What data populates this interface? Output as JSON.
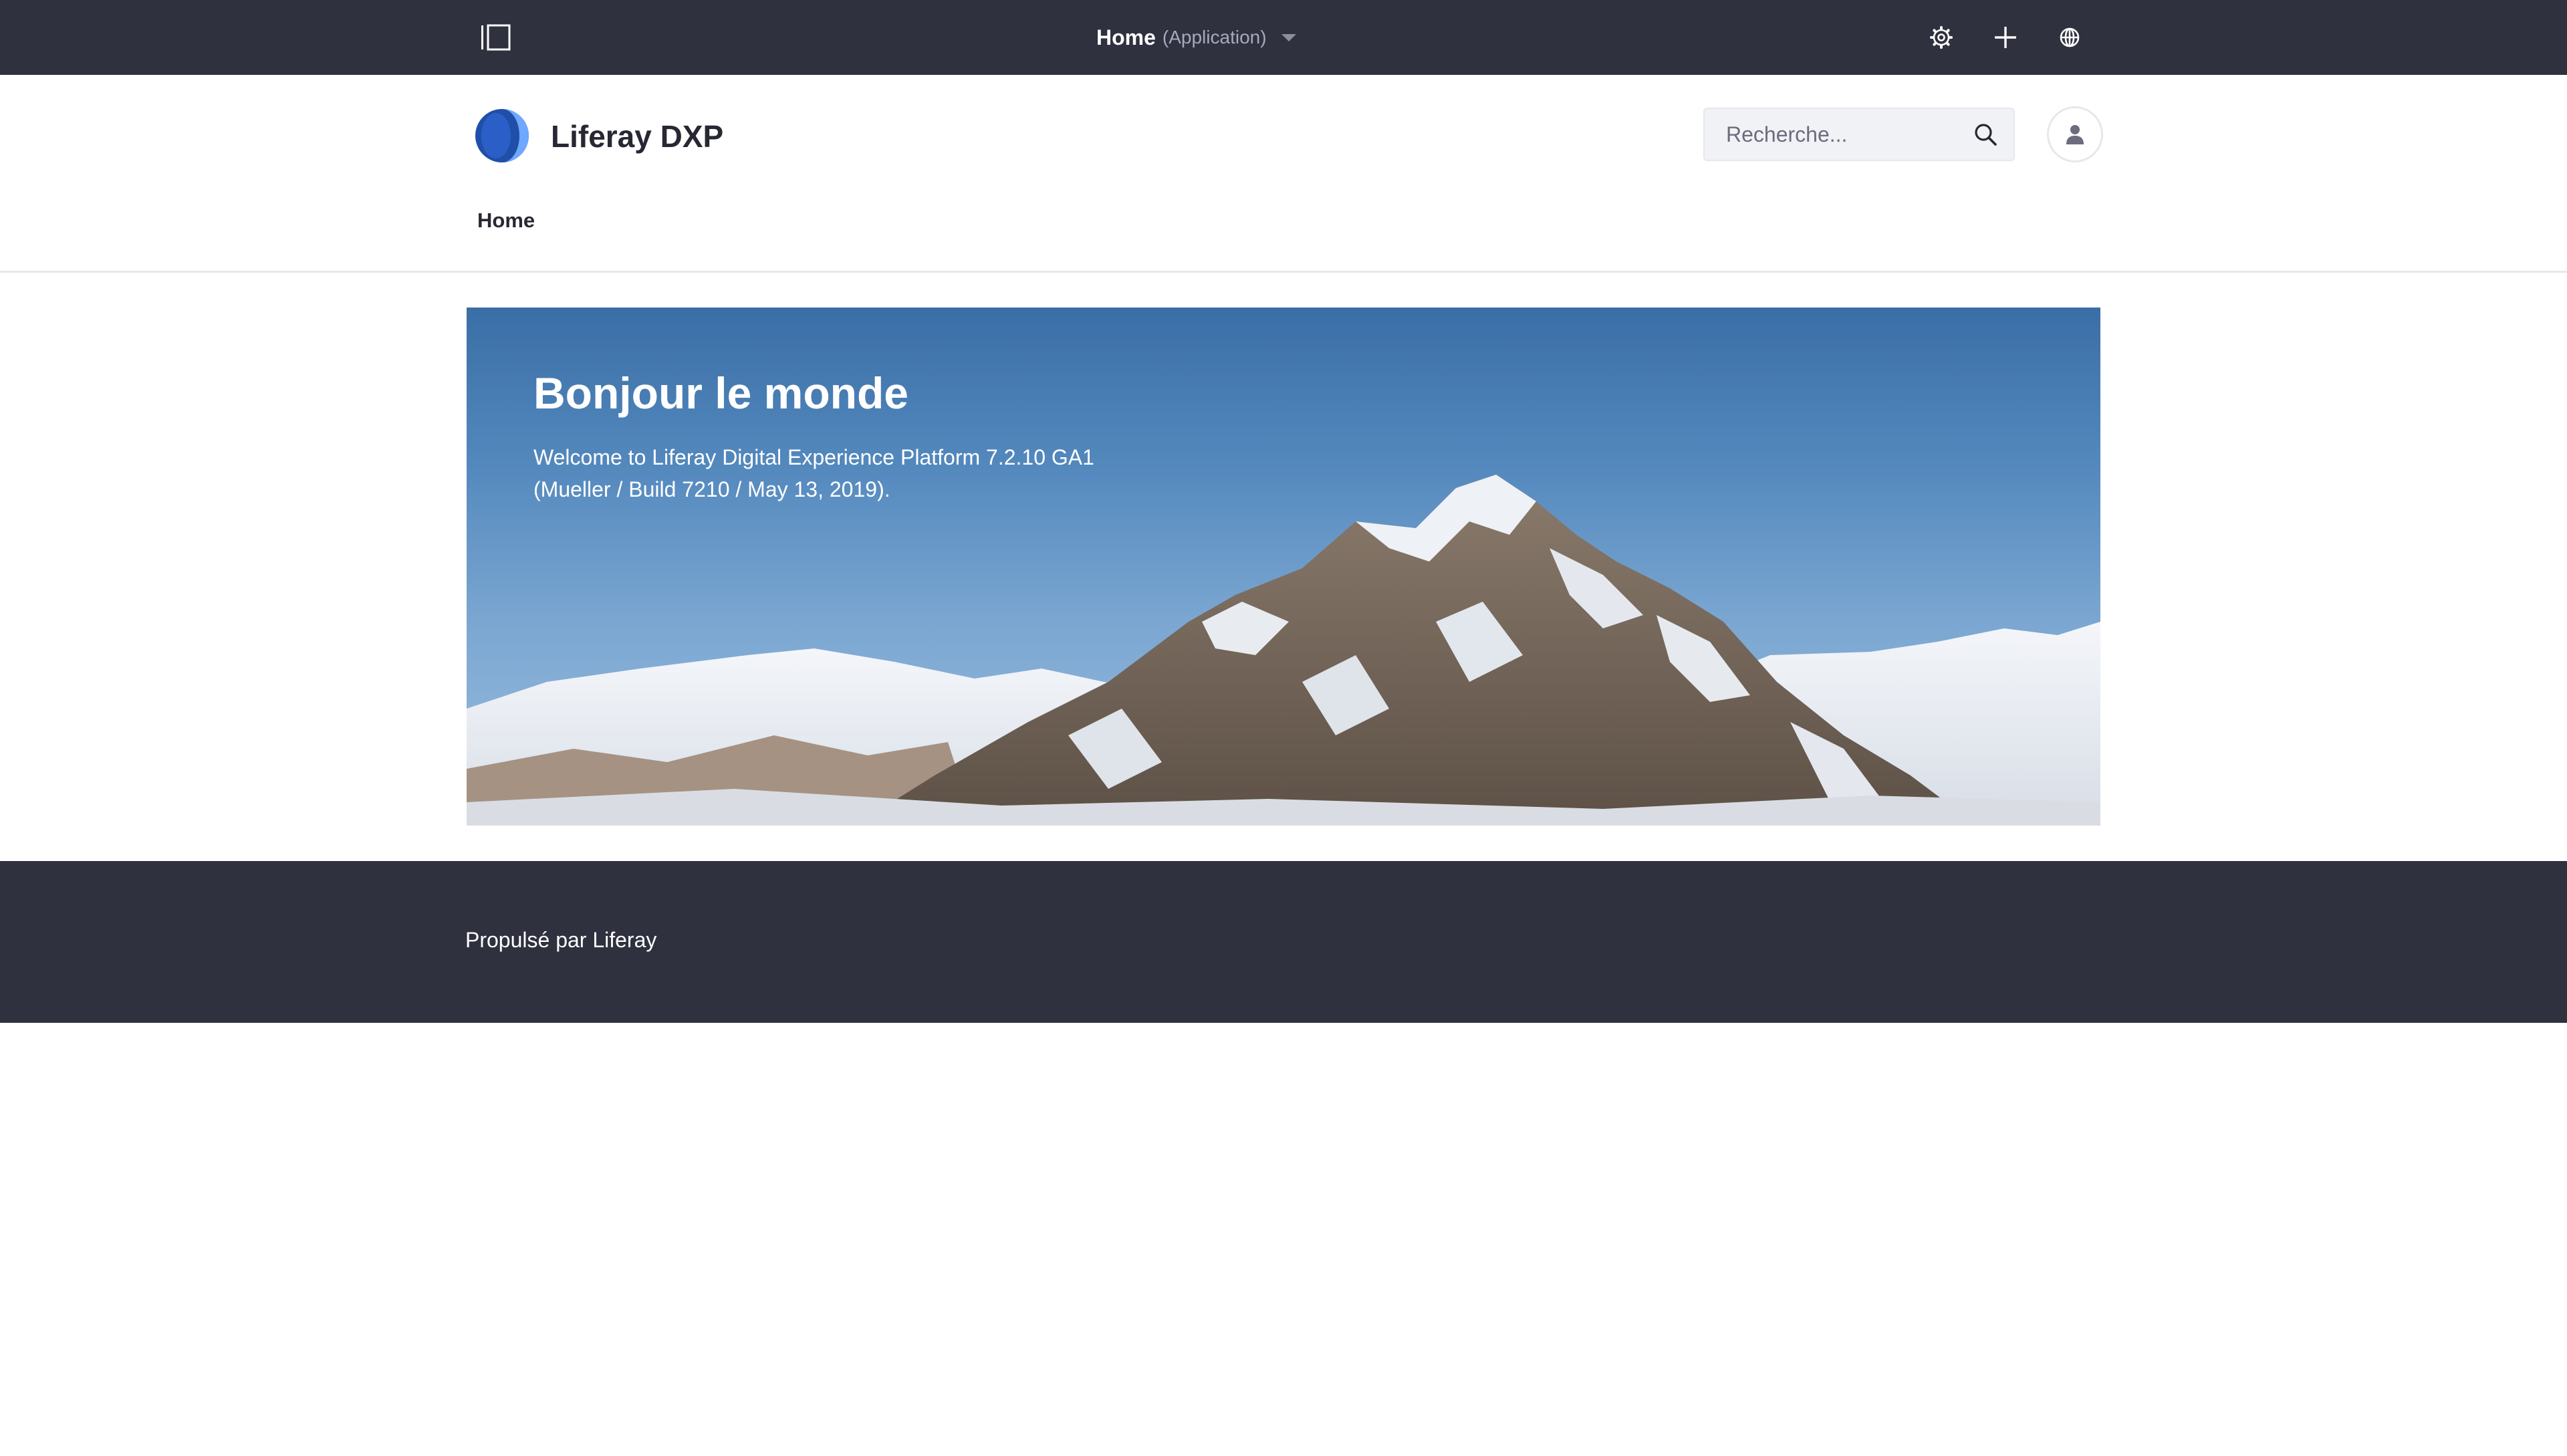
{
  "control_menu": {
    "title": "Home",
    "subtitle": "(Application)",
    "icons": {
      "toggle": "product-menu-icon",
      "gear": "gear-icon",
      "add": "plus-icon",
      "simulation": "simulation-icon"
    }
  },
  "header": {
    "site_name": "Liferay DXP",
    "search": {
      "placeholder": "Recherche..."
    },
    "nav": {
      "items": [
        {
          "label": "Home"
        }
      ]
    }
  },
  "banner": {
    "title": "Bonjour le monde",
    "text": "Welcome to Liferay Digital Experience Platform 7.2.10 GA1 (Mueller / Build 7210 / May 13, 2019)."
  },
  "footer": {
    "text": "Propulsé par Liferay"
  },
  "colors": {
    "topbar": "#30313f",
    "footer": "#30313f",
    "accent": "#0b5fff",
    "logo_dark": "#1f4fa8",
    "logo_light": "#6ea8ff"
  }
}
